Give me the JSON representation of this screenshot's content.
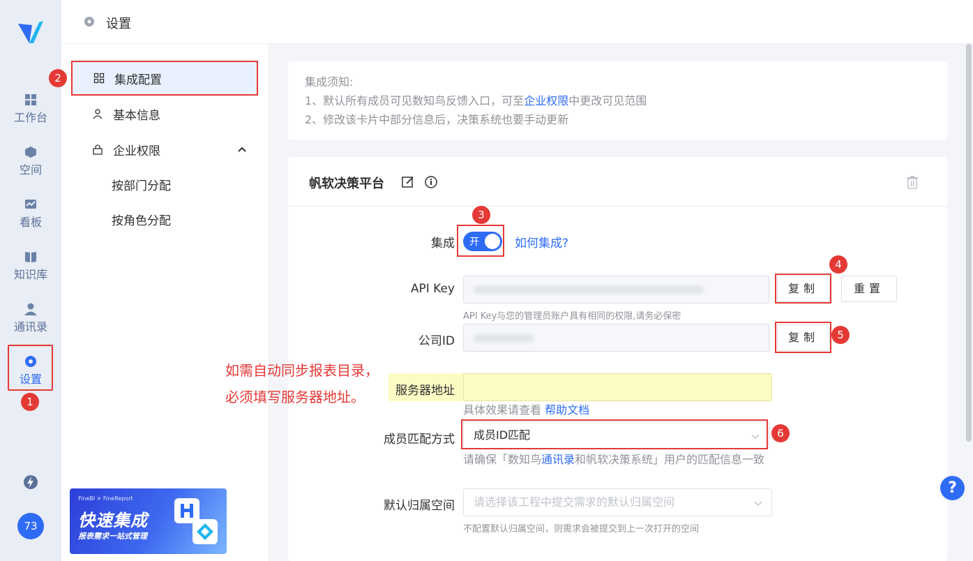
{
  "header": {
    "title": "设置"
  },
  "rail": {
    "items": [
      {
        "label": "工作台",
        "icon": "dashboard-icon"
      },
      {
        "label": "空间",
        "icon": "cube-icon"
      },
      {
        "label": "看板",
        "icon": "chart-board-icon"
      },
      {
        "label": "知识库",
        "icon": "book-icon"
      },
      {
        "label": "通讯录",
        "icon": "contacts-icon"
      },
      {
        "label": "设置",
        "icon": "gear-icon",
        "active": true
      }
    ],
    "avatar": "73"
  },
  "submenu": {
    "items": [
      {
        "label": "集成配置",
        "icon": "grid-icon",
        "active": true
      },
      {
        "label": "基本信息",
        "icon": "user-icon"
      },
      {
        "label": "企业权限",
        "icon": "lock-icon"
      }
    ],
    "children": [
      "按部门分配",
      "按角色分配"
    ],
    "banner": {
      "top": "FineBI × FineReport",
      "title": "快速集成",
      "subtitle": "报表需求一站式管理"
    }
  },
  "notice": {
    "title": "集成须知:",
    "line1_pre": "1、默认所有成员可见数知鸟反馈入口，可至",
    "line1_link": "企业权限",
    "line1_post": "中更改可见范围",
    "line2": "2、修改该卡片中部分信息后，决策系统也要手动更新"
  },
  "card": {
    "title": "帆软决策平台",
    "integrate_label": "集成",
    "toggle_text": "开",
    "how_link": "如何集成?",
    "apikey_label": "API Key",
    "apikey_hint": "API Key与您的管理员账户具有相同的权限,请务必保密",
    "copy_label": "复制",
    "reset_label": "重置",
    "company_label": "公司ID",
    "server_label": "服务器地址",
    "server_hint_pre": "具体效果请查看",
    "server_hint_link": "帮助文档",
    "match_label": "成员匹配方式",
    "match_value": "成员ID匹配",
    "match_hint_pre": "请确保「数知鸟",
    "match_hint_link": "通讯录",
    "match_hint_post": "和帆软决策系统」用户的匹配信息一致",
    "space_label": "默认归属空间",
    "space_placeholder": "请选择该工程中提交需求的默认归属空间",
    "space_hint": "不配置默认归属空间，则需求会被提交到上一次打开的空间"
  },
  "annotation": {
    "note_line1": "如需自动同步报表目录，",
    "note_line2": "必须填写服务器地址。",
    "badges": [
      "1",
      "2",
      "3",
      "4",
      "5",
      "6"
    ]
  },
  "help_fab": "?",
  "colors": {
    "accent": "#2f6cf6",
    "annotation": "#e53935",
    "highlight": "#fdfbc4"
  }
}
